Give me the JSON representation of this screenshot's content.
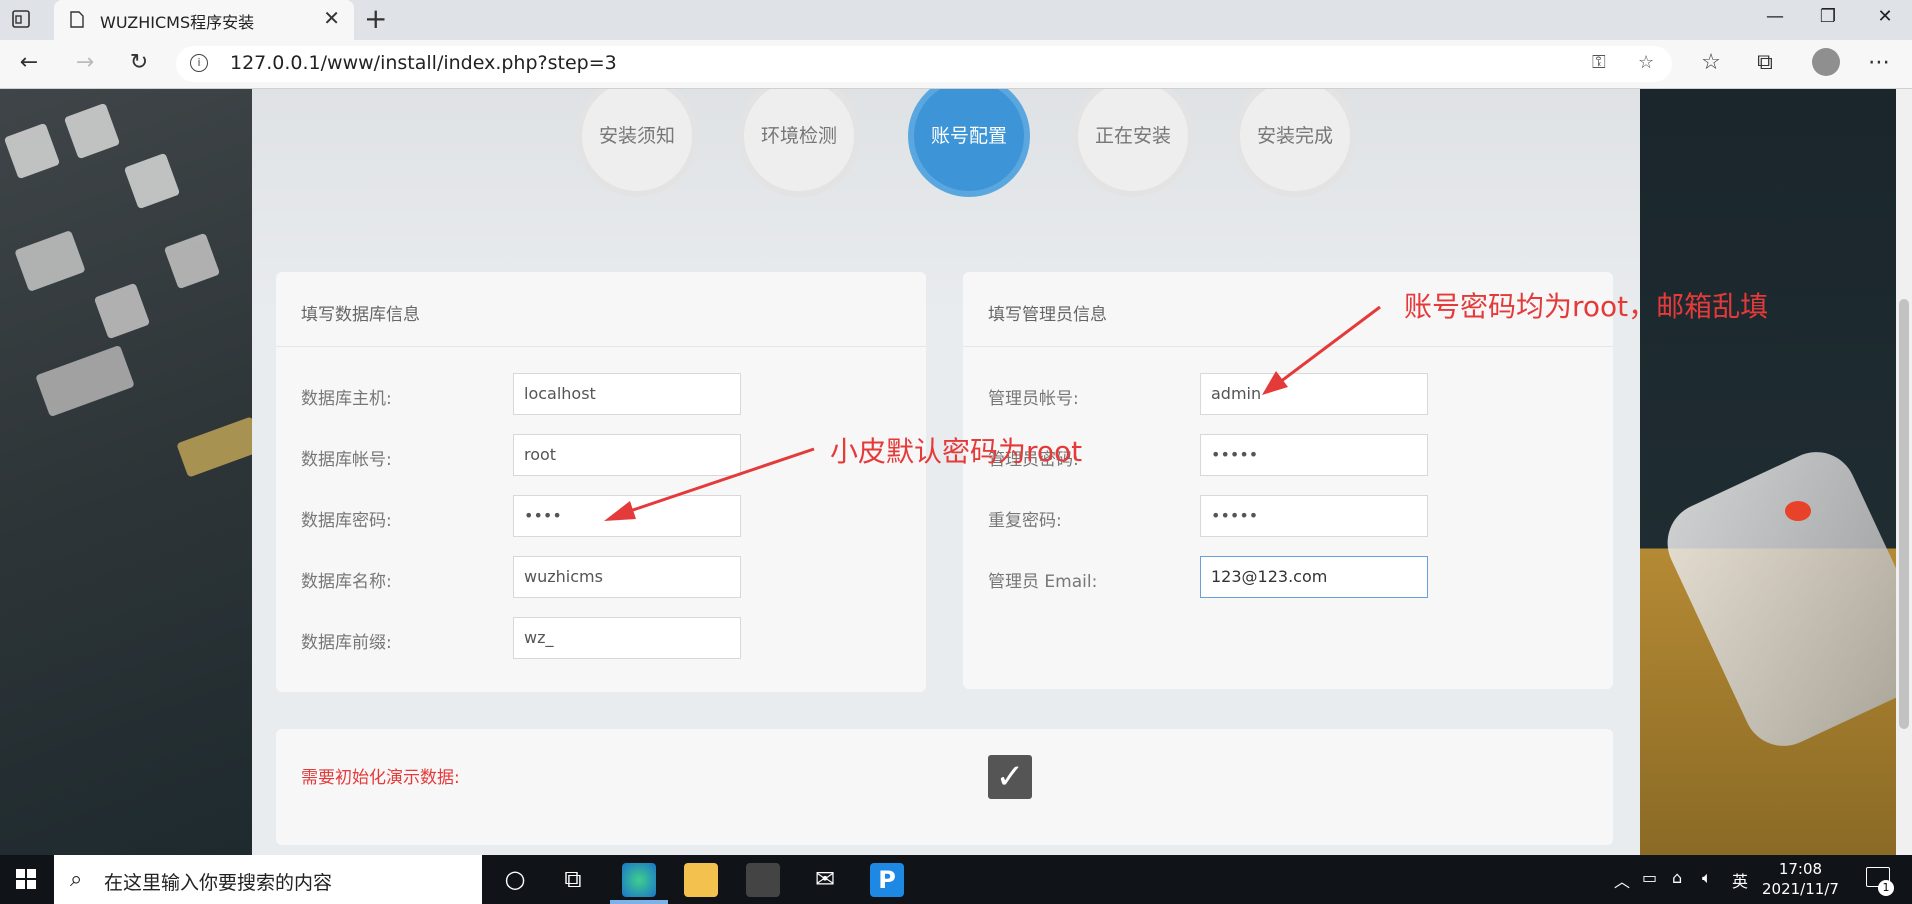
{
  "browser": {
    "tab_title": "WUZHICMS程序安装",
    "url": "127.0.0.1/www/install/index.php?step=3"
  },
  "steps": [
    {
      "label": "安装须知",
      "active": false
    },
    {
      "label": "环境检测",
      "active": false
    },
    {
      "label": "账号配置",
      "active": true
    },
    {
      "label": "正在安装",
      "active": false
    },
    {
      "label": "安装完成",
      "active": false
    }
  ],
  "db_panel": {
    "title": "填写数据库信息",
    "fields": [
      {
        "label": "数据库主机:",
        "value": "localhost"
      },
      {
        "label": "数据库帐号:",
        "value": "root"
      },
      {
        "label": "数据库密码:",
        "value": "••••"
      },
      {
        "label": "数据库名称:",
        "value": "wuzhicms"
      },
      {
        "label": "数据库前缀:",
        "value": "wz_"
      }
    ]
  },
  "admin_panel": {
    "title": "填写管理员信息",
    "fields": [
      {
        "label": "管理员帐号:",
        "value": "admin"
      },
      {
        "label": "管理员密码:",
        "value": "•••••"
      },
      {
        "label": "重复密码:",
        "value": "•••••"
      },
      {
        "label": "管理员 Email:",
        "value": "123@123.com"
      }
    ]
  },
  "demo": {
    "label": "需要初始化演示数据:",
    "checked": true
  },
  "annotations": {
    "db_password_note": "小皮默认密码为root",
    "admin_note": "账号密码均为root，邮箱乱填"
  },
  "taskbar": {
    "search_placeholder": "在这里输入你要搜索的内容",
    "ime": "英",
    "time": "17:08",
    "date": "2021/11/7",
    "notification_count": "1"
  },
  "colors": {
    "active_step": "#3d94d6",
    "annotation": "#e53a3a",
    "demo_label": "#e53a3a"
  }
}
